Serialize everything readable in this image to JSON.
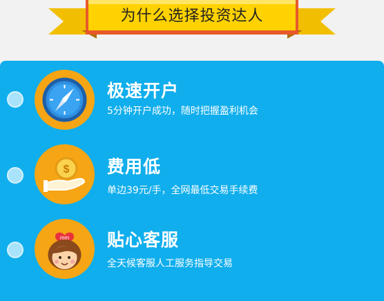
{
  "banner": {
    "title": "为什么选择投资达人"
  },
  "features": [
    {
      "icon": "stopwatch-icon",
      "title": "极速开户",
      "desc": "5分钟开户成功，随时把握盈利机会"
    },
    {
      "icon": "coin-hand-icon",
      "title": "费用低",
      "desc": "单边39元/手，全网最低交易手续费"
    },
    {
      "icon": "service-agent-icon",
      "icon_label": "mm",
      "title": "贴心客服",
      "desc": "全天候客服人工服务指导交易"
    }
  ],
  "colors": {
    "panel": "#10aeec",
    "icon_bg": "#f6a514",
    "ribbon": "#f5c500",
    "ribbon_dark": "#e09a00",
    "ribbon_red": "#e8592a"
  }
}
